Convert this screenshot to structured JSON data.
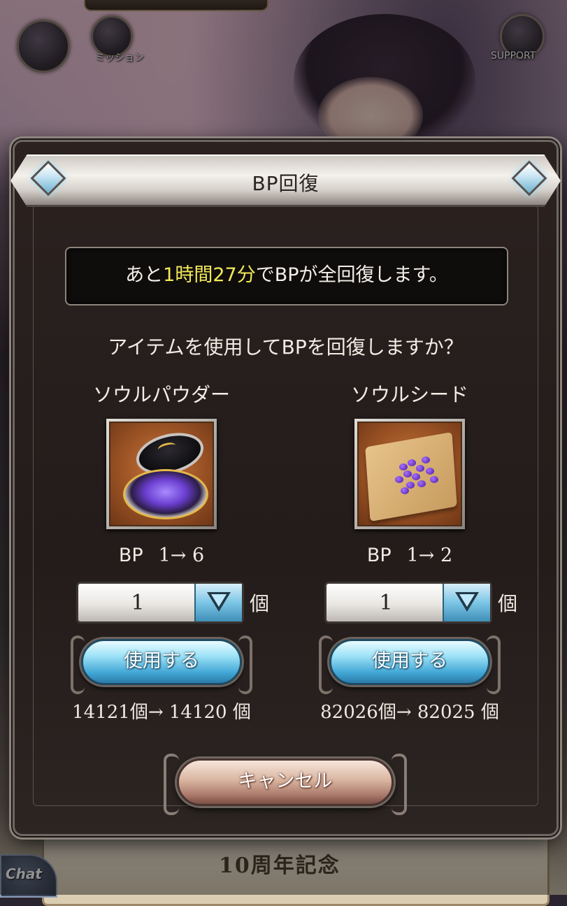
{
  "background": {
    "mission_label": "ミッション",
    "support_label": "SUPPORT",
    "banner_text": "10周年記念",
    "chat_label": "Chat"
  },
  "dialog": {
    "title": "BP回復",
    "info": {
      "prefix": "あと",
      "time": "1時間27分",
      "suffix": "でBPが全回復します。"
    },
    "question": "アイテムを使用してBPを回復しますか？",
    "items": [
      {
        "name": "ソウルパウダー",
        "icon": "soul-powder-icon",
        "bp_label": "BP",
        "bp_change": "1→ 6",
        "quantity": "1",
        "unit": "個",
        "use_label": "使用する",
        "count_change": "14121個→ 14120 個"
      },
      {
        "name": "ソウルシード",
        "icon": "soul-seed-icon",
        "bp_label": "BP",
        "bp_change": "1→ 2",
        "quantity": "1",
        "unit": "個",
        "use_label": "使用する",
        "count_change": "82026個→ 82025 個"
      }
    ],
    "cancel_label": "キャンセル"
  },
  "colors": {
    "highlight": "#f2ea58",
    "use_button": "#43a7d6",
    "cancel_button": "#a9786a"
  }
}
